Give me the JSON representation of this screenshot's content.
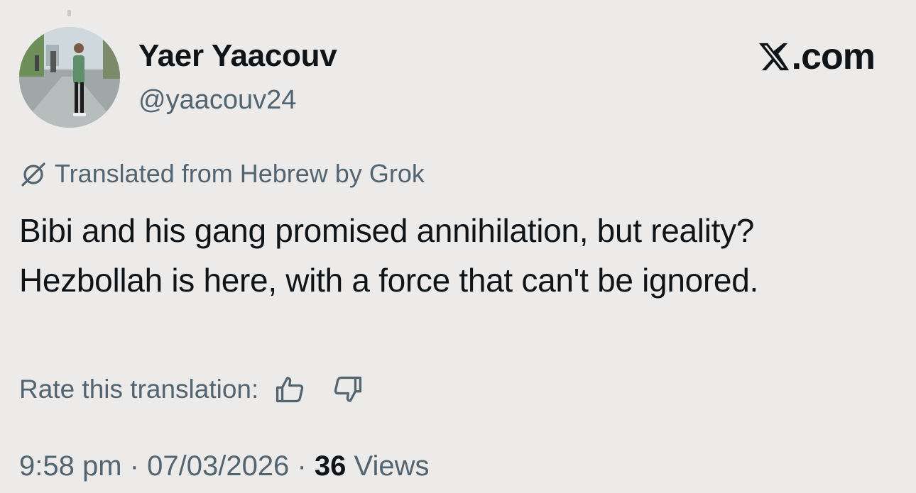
{
  "profile": {
    "display_name": "Yaer Yaacouv",
    "handle": "@yaacouv24",
    "avatar_icon": "user-avatar-photo"
  },
  "brand": {
    "label": ".com",
    "icon": "x-logo-icon"
  },
  "translation": {
    "notice": "Translated from Hebrew by Grok",
    "icon": "grok-icon",
    "rate_label": "Rate this translation:",
    "thumbs_up_icon": "thumbs-up-icon",
    "thumbs_down_icon": "thumbs-down-icon"
  },
  "tweet": {
    "text": "Bibi and his gang promised annihilation, but reality? Hezbollah is here, with a force that can't be ignored."
  },
  "meta": {
    "time": "9:58 pm",
    "separator": "·",
    "date": "07/03/2026",
    "views_count": "36",
    "views_label": "Views"
  },
  "colors": {
    "background": "#ecebea",
    "text_primary": "#0f1419",
    "text_secondary": "#536471"
  }
}
